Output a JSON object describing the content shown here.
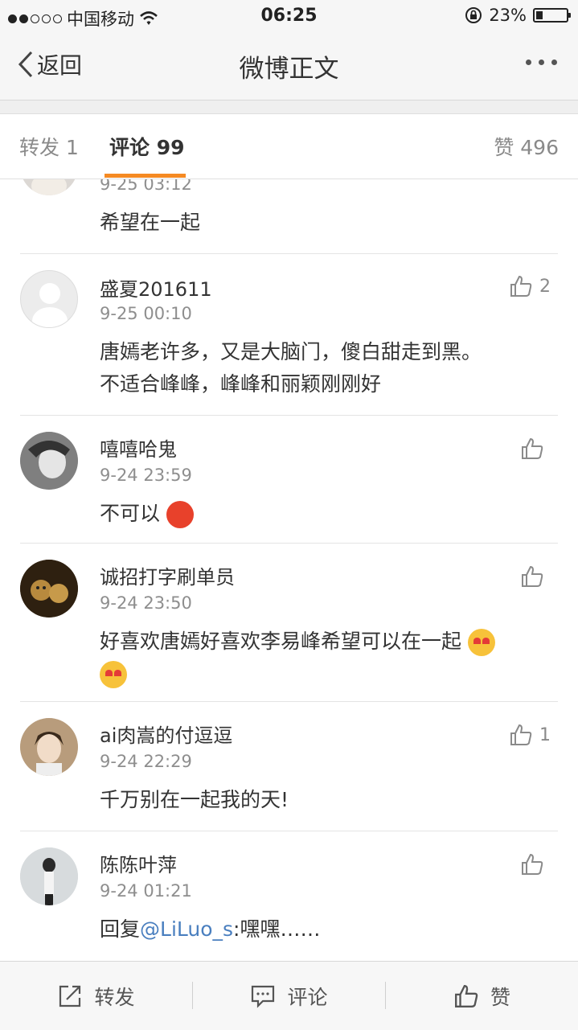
{
  "status_bar": {
    "carrier": "中国移动",
    "time": "06:25",
    "battery_percent": "23%",
    "battery_level": 0.23,
    "signal_bars": 2
  },
  "nav": {
    "back_label": "返回",
    "title": "微博正文",
    "more_icon": "more-icon"
  },
  "tabs": {
    "repost": "转发 1",
    "comments": "评论 99",
    "likes": "赞 496"
  },
  "comments": [
    {
      "username": "",
      "time": "9-25 03:12",
      "text": "希望在一起",
      "likes": ""
    },
    {
      "username": "盛夏201611",
      "time": "9-25 00:10",
      "text": "唐嫣老许多，又是大脑门，傻白甜走到黑。",
      "text2": "不适合峰峰，峰峰和丽颖刚刚好",
      "likes": "2"
    },
    {
      "username": "嘻嘻哈鬼",
      "time": "9-24 23:59",
      "text": "不可以",
      "likes": ""
    },
    {
      "username": "诚招打字刷单员",
      "time": "9-24 23:50",
      "text": "好喜欢唐嫣好喜欢李易峰希望可以在一起",
      "likes": ""
    },
    {
      "username": "ai肉嵩的付逗逗",
      "time": "9-24 22:29",
      "text": "千万别在一起我的天!",
      "likes": "1"
    },
    {
      "username": "陈陈叶萍",
      "time": "9-24 01:21",
      "text_prefix": "回复",
      "mention": "@LiLuo_s",
      "text_suffix": ":嘿嘿……",
      "likes": ""
    }
  ],
  "bottom_bar": {
    "repost": "转发",
    "comment": "评论",
    "like": "赞"
  },
  "colors": {
    "accent": "#f58a23",
    "mention": "#4a7fbf"
  }
}
